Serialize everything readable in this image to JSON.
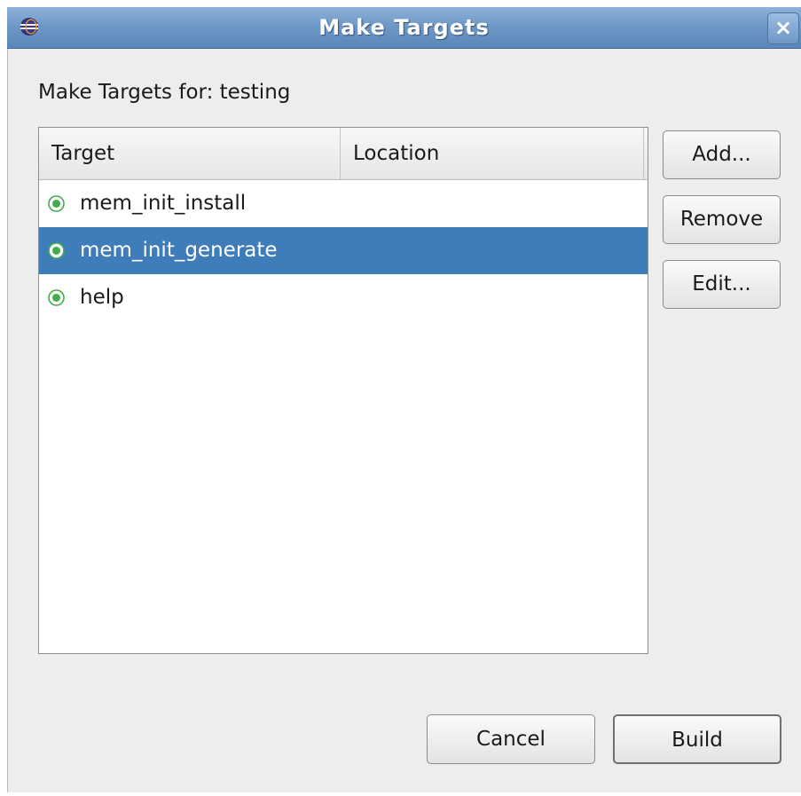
{
  "window": {
    "title": "Make Targets",
    "close_label": "×"
  },
  "dialog": {
    "heading": "Make Targets for: testing"
  },
  "table": {
    "columns": [
      "Target",
      "Location"
    ],
    "rows": [
      {
        "target": "mem_init_install",
        "location": "",
        "selected": false
      },
      {
        "target": "mem_init_generate",
        "location": "",
        "selected": true
      },
      {
        "target": "help",
        "location": "",
        "selected": false
      }
    ]
  },
  "buttons": {
    "add": "Add...",
    "remove": "Remove",
    "edit": "Edit...",
    "cancel": "Cancel",
    "build": "Build"
  },
  "icons": {
    "title": "eclipse-icon",
    "target": "make-target-icon"
  },
  "colors": {
    "titlebar": "#6e98c6",
    "selection": "#3f7cba",
    "target_icon": "#3fae4a"
  }
}
